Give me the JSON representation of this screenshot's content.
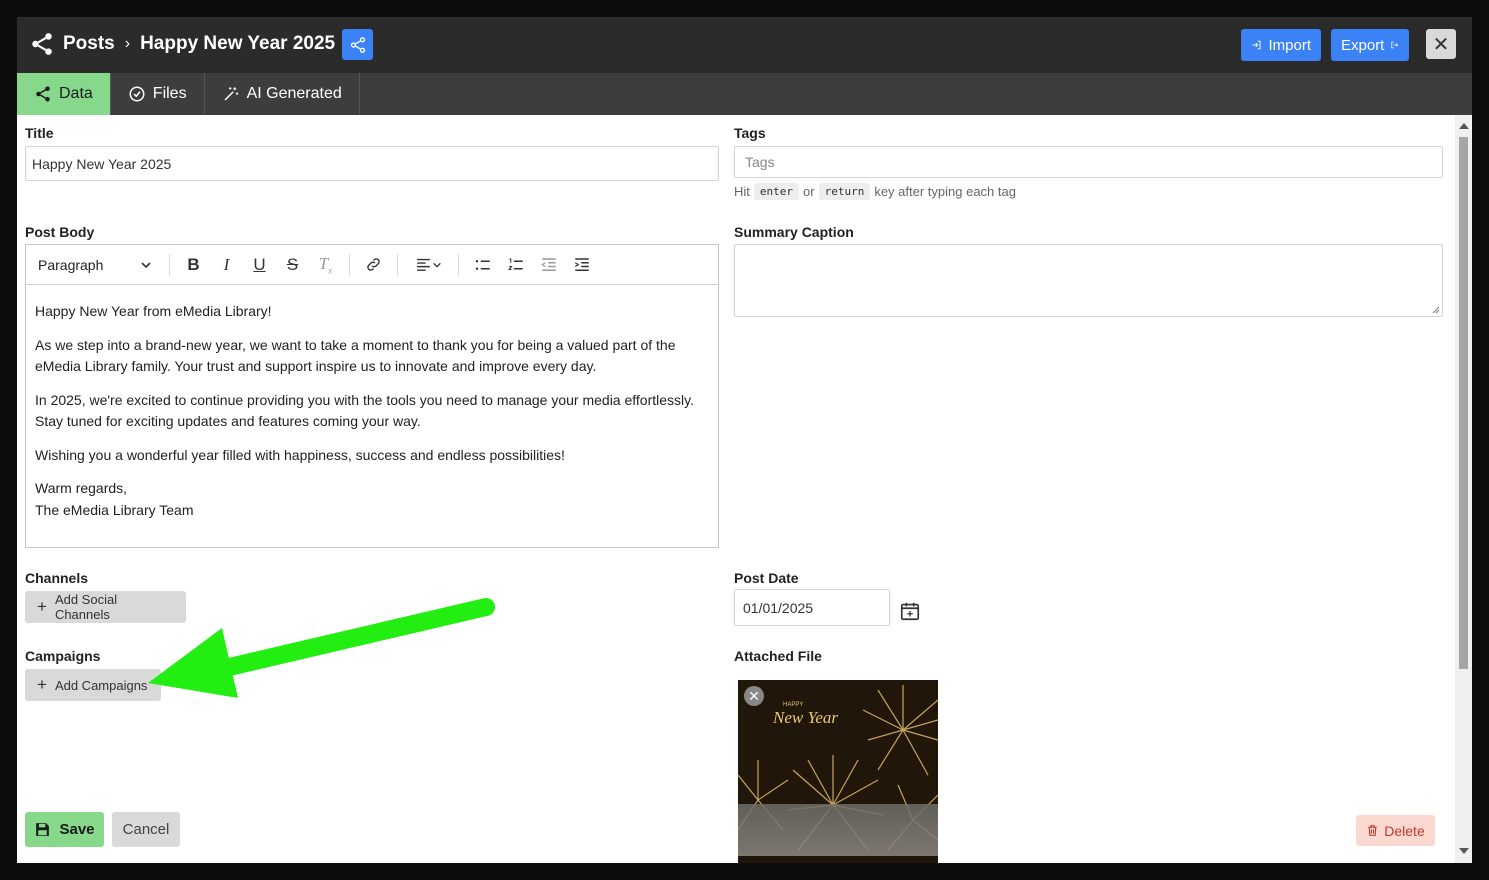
{
  "header": {
    "breadcrumb_root": "Posts",
    "breadcrumb_sep": "›",
    "breadcrumb_current": "Happy New Year 2025",
    "import_label": "Import",
    "export_label": "Export",
    "close_glyph": "✕"
  },
  "tabs": [
    {
      "label": "Data",
      "icon": "share-icon",
      "active": true
    },
    {
      "label": "Files",
      "icon": "check-circle-icon",
      "active": false
    },
    {
      "label": "AI Generated",
      "icon": "magic-wand-icon",
      "active": false
    }
  ],
  "form": {
    "title_label": "Title",
    "title_value": "Happy New Year 2025",
    "tags_label": "Tags",
    "tags_placeholder": "Tags",
    "tags_hint_pre": "Hit",
    "tags_hint_key1": "enter",
    "tags_hint_or": "or",
    "tags_hint_key2": "return",
    "tags_hint_post": "key after typing each tag",
    "post_body_label": "Post Body",
    "summary_label": "Summary Caption",
    "channels_label": "Channels",
    "add_channels_label": "Add Social Channels",
    "campaigns_label": "Campaigns",
    "add_campaigns_label": "Add Campaigns",
    "post_date_label": "Post Date",
    "post_date_value": "01/01/2025",
    "attached_file_label": "Attached File"
  },
  "editor": {
    "block_format": "Paragraph",
    "paragraphs": [
      "Happy New Year from eMedia Library!",
      "As we step into a brand-new year, we want to take a moment to thank you for being a valued part of the eMedia Library family. Your trust and support inspire us to innovate and improve every day.",
      "In 2025, we're excited to continue providing you with the tools you need to manage your media effortlessly. Stay tuned for exciting updates and features coming your way.",
      "Wishing you a wonderful year filled with happiness, success and endless possibilities!",
      "Warm regards,",
      "The eMedia Library Team"
    ]
  },
  "thumbnail": {
    "small_text": "HAPPY",
    "script_text": "New Year",
    "remove_glyph": "✕"
  },
  "footer": {
    "save_label": "Save",
    "cancel_label": "Cancel",
    "delete_label": "Delete"
  },
  "colors": {
    "accent_green": "#86d98a",
    "accent_blue": "#3b82f6",
    "annotation_arrow": "#22ee11",
    "delete_red": "#c0392b"
  }
}
